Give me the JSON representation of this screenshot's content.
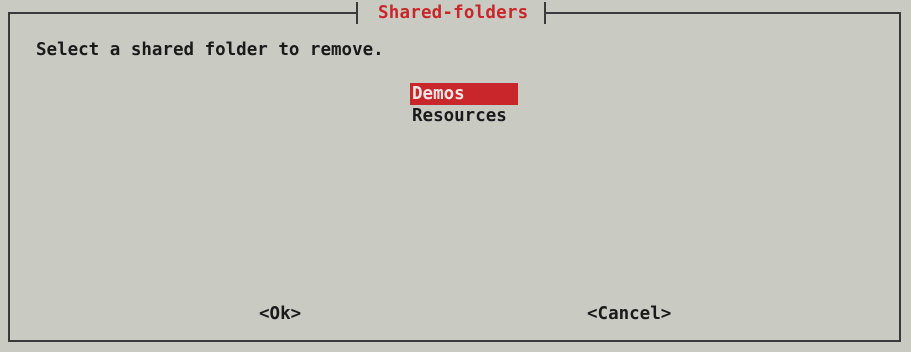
{
  "dialog": {
    "title": "Shared-folders",
    "prompt": "Select a shared folder to remove.",
    "items": [
      {
        "label": "Demos",
        "selected": true
      },
      {
        "label": "Resources",
        "selected": false
      }
    ],
    "buttons": {
      "ok": "<Ok>",
      "cancel": "<Cancel>"
    }
  },
  "colors": {
    "background": "#c9cbc3",
    "accent": "#c8262a",
    "border": "#3a3a3a"
  }
}
